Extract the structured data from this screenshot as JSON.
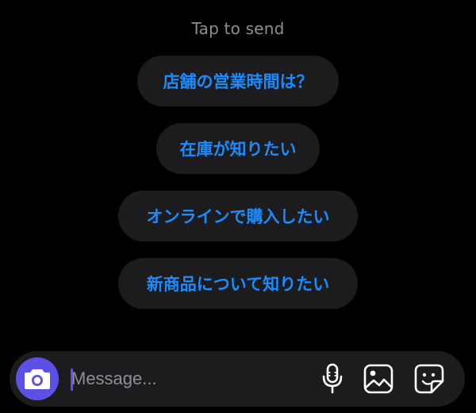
{
  "hint": {
    "text": "Tap to send"
  },
  "quick_replies": [
    {
      "label": "店舗の営業時間は？"
    },
    {
      "label": "在庫が知りたい"
    },
    {
      "label": "オンラインで購入したい"
    },
    {
      "label": "新商品について知りたい"
    }
  ],
  "composer": {
    "placeholder": "Message...",
    "value": ""
  },
  "icons": {
    "camera": "camera-icon",
    "mic": "microphone-icon",
    "gallery": "image-icon",
    "sticker": "sticker-icon"
  },
  "colors": {
    "accent": "#5b51e8",
    "reply_text": "#1a8cff",
    "hint_text": "#8e8e93",
    "bubble": "#1c1c1e"
  }
}
